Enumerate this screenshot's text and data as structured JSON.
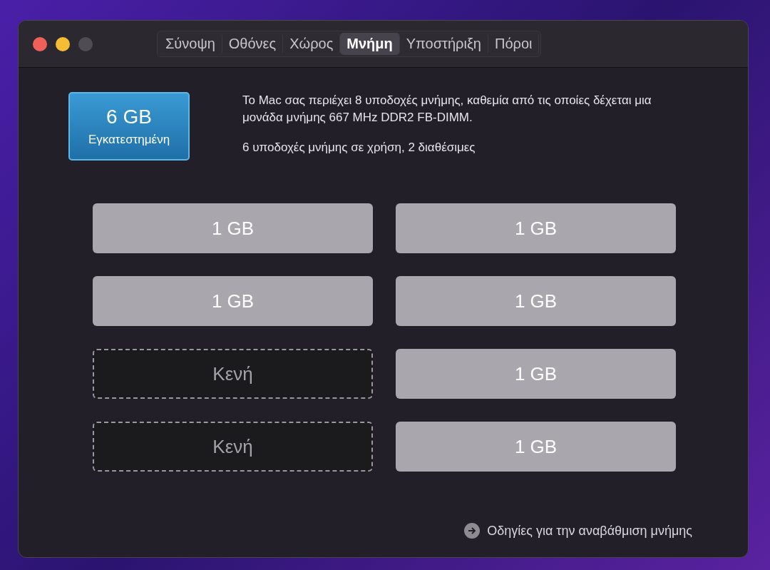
{
  "tabs": [
    {
      "label": "Σύνοψη",
      "selected": false
    },
    {
      "label": "Οθόνες",
      "selected": false
    },
    {
      "label": "Χώρος",
      "selected": false
    },
    {
      "label": "Μνήμη",
      "selected": true
    },
    {
      "label": "Υποστήριξη",
      "selected": false
    },
    {
      "label": "Πόροι",
      "selected": false
    }
  ],
  "installed": {
    "amount": "6 GB",
    "label": "Εγκατεστημένη"
  },
  "description": "Το Mac σας περιέχει 8 υποδοχές μνήμης, καθεμία από τις οποίες δέχεται μια μονάδα μνήμης 667 MHz DDR2 FB-DIMM.",
  "usage": "6 υποδοχές μνήμης σε χρήση, 2 διαθέσιμες",
  "slots": [
    {
      "kind": "filled",
      "label": "1 GB"
    },
    {
      "kind": "filled",
      "label": "1 GB"
    },
    {
      "kind": "filled",
      "label": "1 GB"
    },
    {
      "kind": "filled",
      "label": "1 GB"
    },
    {
      "kind": "empty",
      "label": "Κενή"
    },
    {
      "kind": "filled",
      "label": "1 GB"
    },
    {
      "kind": "empty",
      "label": "Κενή"
    },
    {
      "kind": "filled",
      "label": "1 GB"
    }
  ],
  "upgrade_link": "Οδηγίες για την αναβάθμιση μνήμης"
}
